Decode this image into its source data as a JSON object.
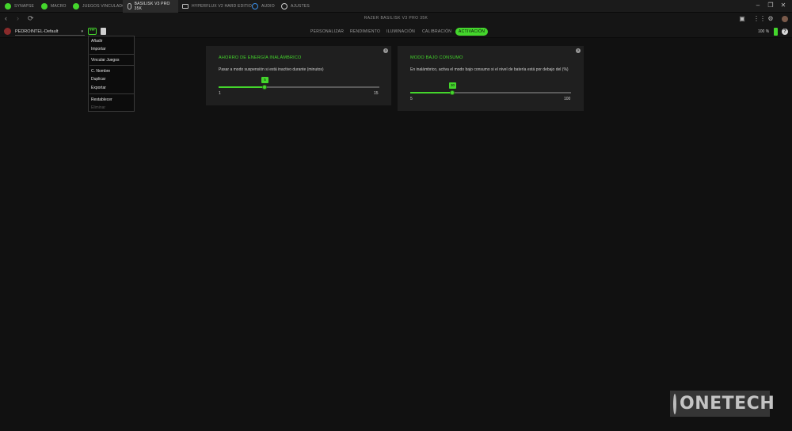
{
  "tabs": [
    {
      "label": "SYNAPSE",
      "icon": "synapse-icon"
    },
    {
      "label": "MACRO",
      "icon": "macro-icon"
    },
    {
      "label": "JUEGOS VINCULADOS",
      "icon": "games-icon"
    },
    {
      "label": "BASILISK V3 PRO 35K",
      "icon": "mouse-icon"
    },
    {
      "label": "HYPERFLUX V2 HARD EDITIO",
      "icon": "mousepad-icon"
    },
    {
      "label": "AUDIO",
      "icon": "audio-icon"
    },
    {
      "label": "AJUSTES",
      "icon": "gear-icon"
    }
  ],
  "device_title": "RAZER BASILISK V3 PRO 35K",
  "profile": {
    "name": "PEDROINTEL-Default"
  },
  "menu_tabs": [
    "PERSONALIZAR",
    "RENDIMIENTO",
    "ILUMINACIÓN",
    "CALIBRACIÓN",
    "ACTIVACIÓN"
  ],
  "active_menu_tab": "ACTIVACIÓN",
  "battery": {
    "label": "100 %"
  },
  "dropdown": {
    "add": "Añadir",
    "import": "Importar",
    "link_games": "Vincular Juegos",
    "rename": "C. Nombre",
    "duplicate": "Duplicar",
    "export": "Exportar",
    "reset": "Restablecer",
    "delete": "Eliminar"
  },
  "panel_power": {
    "title": "AHORRO DE ENERGÍA INALÁMBRICO",
    "desc": "Pasar a modo suspensión si está inactivo durante (minutos)",
    "value": "5",
    "min": "1",
    "max": "15",
    "fraction": 0.2857
  },
  "panel_lowpower": {
    "title": "MODO BAJO CONSUMO",
    "desc": "En inalámbrico, activa el modo bajo consumo si el nivel de batería está por debajo del (%)",
    "value": "30",
    "min": "5",
    "max": "100",
    "fraction": 0.2632
  },
  "watermark": "ONETECH",
  "colors": {
    "accent": "#44d62c",
    "background": "#111111",
    "panel": "#1f1f1f"
  }
}
